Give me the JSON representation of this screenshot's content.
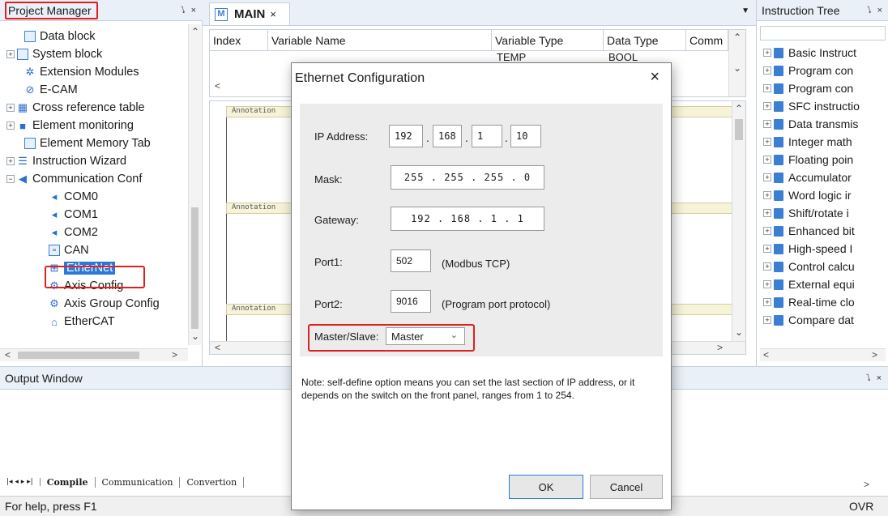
{
  "project_manager": {
    "title": "Project Manager",
    "controls": "⭝ ×",
    "items": [
      {
        "label": "Data block",
        "icon": "doc-icon"
      },
      {
        "label": "System block",
        "icon": "doc-icon"
      },
      {
        "label": "Extension Modules",
        "icon": "gear-icon"
      },
      {
        "label": "E-CAM",
        "icon": "cam-icon"
      },
      {
        "label": "Cross reference table",
        "icon": "grid-icon"
      },
      {
        "label": "Element monitoring",
        "icon": "monitor-icon"
      },
      {
        "label": "Element Memory Tab",
        "icon": "doc-icon"
      },
      {
        "label": "Instruction Wizard",
        "icon": "list-icon"
      },
      {
        "label": "Communication Conf",
        "icon": "comm-icon"
      },
      {
        "label": "COM0",
        "icon": "port-icon"
      },
      {
        "label": "COM1",
        "icon": "port-icon"
      },
      {
        "label": "COM2",
        "icon": "port-icon"
      },
      {
        "label": "CAN",
        "icon": "can-icon"
      },
      {
        "label": "EtherNet",
        "icon": "network-icon"
      },
      {
        "label": "Axis Config",
        "icon": "axis-icon"
      },
      {
        "label": "Axis Group Config",
        "icon": "axis-group-icon"
      },
      {
        "label": "EtherCAT",
        "icon": "ethercat-icon"
      }
    ]
  },
  "editor": {
    "tab_label": "MAIN",
    "tab_icon_letter": "M",
    "columns": [
      "Index",
      "Variable Name",
      "Variable Type",
      "Data Type",
      "Comm"
    ],
    "row": {
      "variable_type": "TEMP",
      "data_type": "BOOL"
    },
    "annotation_label": "Annotation"
  },
  "instruction_tree": {
    "title": "Instruction Tree",
    "items": [
      "Basic Instruct",
      "Program con",
      "Program con",
      "SFC instructio",
      "Data transmis",
      "Integer math",
      "Floating poin",
      "Accumulator",
      "Word logic ir",
      "Shift/rotate i",
      "Enhanced bit",
      "High-speed I",
      "Control calcu",
      "External equi",
      "Real-time clo",
      "Compare dat"
    ]
  },
  "output_window": {
    "title": "Output Window",
    "tabs": [
      "Compile",
      "Communication",
      "Convertion"
    ]
  },
  "status_bar": {
    "help_text": "For help, press F1",
    "mode": "OVR"
  },
  "dialog": {
    "title": "Ethernet Configuration",
    "ip_label": "IP Address:",
    "ip": [
      "192",
      "168",
      "1",
      "10"
    ],
    "mask_label": "Mask:",
    "mask": "255 . 255 . 255 .  0",
    "gateway_label": "Gateway:",
    "gateway": "192 . 168 .  1  .  1",
    "port1_label": "Port1:",
    "port1": "502",
    "port1_note": "(Modbus TCP)",
    "port2_label": "Port2:",
    "port2": "9016",
    "port2_note": "(Program port protocol)",
    "ms_label": "Master/Slave:",
    "ms_value": "Master",
    "note": "Note: self-define option means you can set the last section of IP address, or it depends on the switch on the front panel, ranges from 1 to 254.",
    "ok_label": "OK",
    "cancel_label": "Cancel"
  },
  "colors": {
    "accent": "#2b78d8",
    "highlight_outline": "#e02020",
    "rung_fill": "#f6f3d8"
  }
}
